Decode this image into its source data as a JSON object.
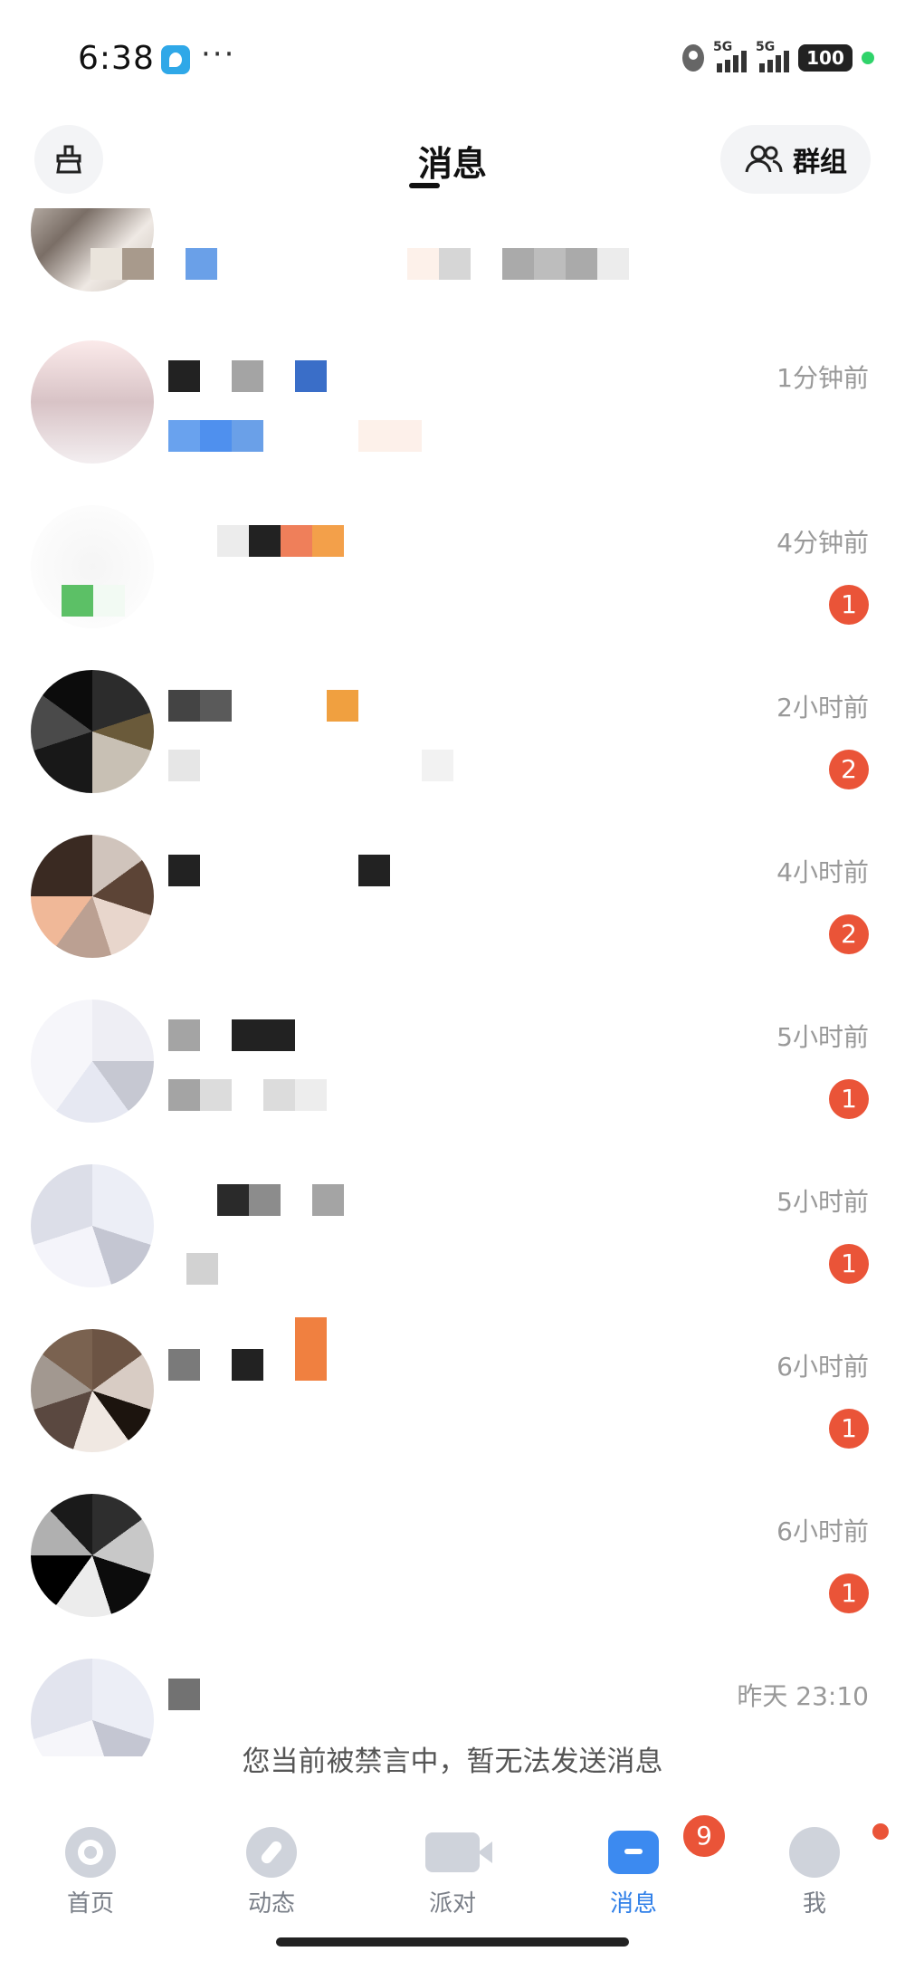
{
  "status": {
    "time": "6:38",
    "more": "···",
    "sim1": "5G",
    "sim2": "5G",
    "battery": "100"
  },
  "header": {
    "title": "消息",
    "group_label": "群组"
  },
  "conversations": [
    {
      "time": "1分钟前",
      "unread": ""
    },
    {
      "time": "4分钟前",
      "unread": "1"
    },
    {
      "time": "2小时前",
      "unread": "2"
    },
    {
      "time": "4小时前",
      "unread": "2"
    },
    {
      "time": "5小时前",
      "unread": "1"
    },
    {
      "time": "5小时前",
      "unread": "1"
    },
    {
      "time": "6小时前",
      "unread": "1"
    },
    {
      "time": "6小时前",
      "unread": "1"
    },
    {
      "time": "昨天 23:10",
      "unread": ""
    }
  ],
  "muted_notice": "您当前被禁言中，暂无法发送消息",
  "nav": {
    "home": "首页",
    "feed": "动态",
    "party": "派对",
    "messages": "消息",
    "messages_badge": "9",
    "me": "我"
  },
  "icons": {
    "clean": "broom-icon",
    "group": "group-icon",
    "home": "home-icon",
    "feed": "compass-icon",
    "party": "video-icon",
    "messages": "chat-icon",
    "me": "profile-icon"
  },
  "colors": {
    "accent": "#2f7fe8",
    "badge": "#ea5438",
    "muted_text": "#999999"
  }
}
